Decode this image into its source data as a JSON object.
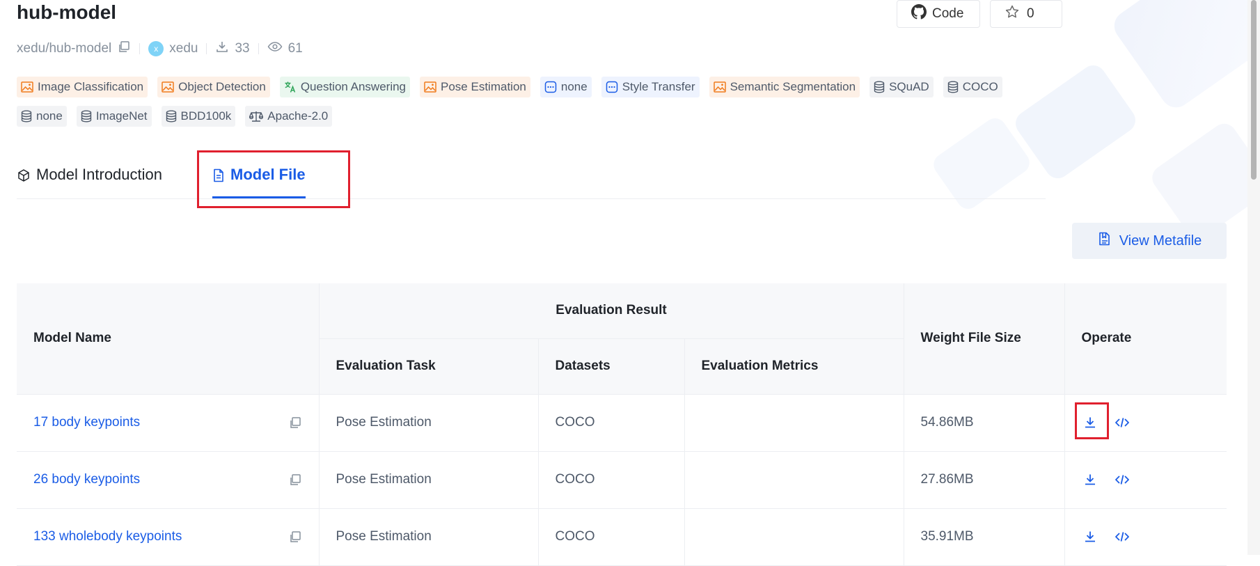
{
  "header": {
    "title": "hub-model",
    "code_label": "Code",
    "star_count": "0"
  },
  "meta": {
    "repo_path": "xedu/hub-model",
    "avatar_letter": "x",
    "owner": "xedu",
    "downloads": "33",
    "views": "61"
  },
  "tags": [
    {
      "label": "Image Classification",
      "kind": "task",
      "icon": "image-icon"
    },
    {
      "label": "Object Detection",
      "kind": "task",
      "icon": "image-icon"
    },
    {
      "label": "Question Answering",
      "kind": "qa",
      "icon": "translate-icon"
    },
    {
      "label": "Pose Estimation",
      "kind": "task",
      "icon": "image-icon"
    },
    {
      "label": "none",
      "kind": "other",
      "icon": "more-icon"
    },
    {
      "label": "Style Transfer",
      "kind": "other",
      "icon": "more-icon"
    },
    {
      "label": "Semantic Segmentation",
      "kind": "task",
      "icon": "image-icon"
    },
    {
      "label": "SQuAD",
      "kind": "dataset",
      "icon": "database-icon"
    },
    {
      "label": "COCO",
      "kind": "dataset",
      "icon": "database-icon"
    },
    {
      "label": "none",
      "kind": "dataset",
      "icon": "database-icon"
    },
    {
      "label": "ImageNet",
      "kind": "dataset",
      "icon": "database-icon"
    },
    {
      "label": "BDD100k",
      "kind": "dataset",
      "icon": "database-icon"
    },
    {
      "label": "Apache-2.0",
      "kind": "license",
      "icon": "scale-icon"
    }
  ],
  "tabs": [
    {
      "label": "Model Introduction",
      "active": false
    },
    {
      "label": "Model File",
      "active": true
    }
  ],
  "view_metafile_label": "View Metafile",
  "table": {
    "headers": {
      "model_name": "Model Name",
      "evaluation_result": "Evaluation Result",
      "evaluation_task": "Evaluation Task",
      "datasets": "Datasets",
      "evaluation_metrics": "Evaluation Metrics",
      "weight_file_size": "Weight File Size",
      "operate": "Operate"
    },
    "rows": [
      {
        "name": "17 body keypoints",
        "task": "Pose Estimation",
        "dataset": "COCO",
        "metrics": "",
        "size": "54.86MB"
      },
      {
        "name": "26 body keypoints",
        "task": "Pose Estimation",
        "dataset": "COCO",
        "metrics": "",
        "size": "27.86MB"
      },
      {
        "name": "133 wholebody keypoints",
        "task": "Pose Estimation",
        "dataset": "COCO",
        "metrics": "",
        "size": "35.91MB"
      }
    ]
  },
  "colors": {
    "accent": "#1a5ce6",
    "highlight": "#e0202e",
    "task_tag_icon": "#f07a1c",
    "qa_tag_icon": "#2ea458"
  }
}
